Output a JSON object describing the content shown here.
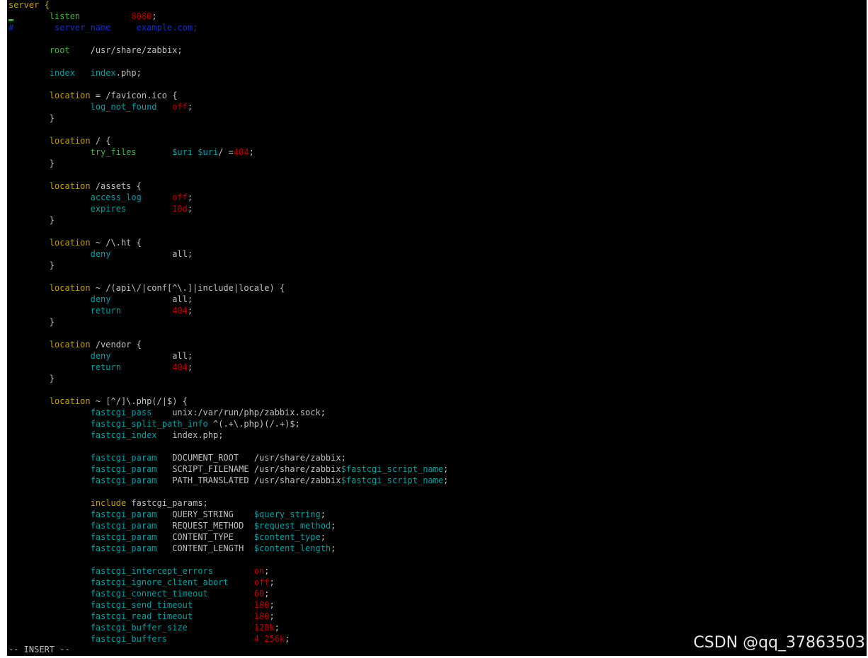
{
  "colors": {
    "default": "#c0c0c0",
    "keyword": "#c0a000",
    "directive": "#00a0a0",
    "value": "#c00000",
    "comment": "#1030c0",
    "green": "#40b040"
  },
  "editor": {
    "mode": "-- INSERT --",
    "lines": [
      [
        [
          "server {",
          "keyword"
        ]
      ],
      [
        [
          "        ",
          ""
        ],
        [
          "listen",
          "green"
        ],
        [
          "          ",
          ""
        ],
        [
          "8080",
          "value"
        ],
        [
          ";",
          ""
        ]
      ],
      [
        [
          "#",
          "comment"
        ],
        [
          "        server_name     example.com;",
          "comment"
        ]
      ],
      [],
      [
        [
          "        ",
          ""
        ],
        [
          "root",
          "green"
        ],
        [
          "    /usr/share/zabbix;",
          ""
        ]
      ],
      [],
      [
        [
          "        ",
          ""
        ],
        [
          "index",
          "directive"
        ],
        [
          "   ",
          ""
        ],
        [
          "index",
          "directive"
        ],
        [
          ".php;",
          ""
        ]
      ],
      [],
      [
        [
          "        ",
          ""
        ],
        [
          "location",
          "keyword"
        ],
        [
          " = /favicon.ico {",
          ""
        ]
      ],
      [
        [
          "                ",
          ""
        ],
        [
          "log_not_found",
          "directive"
        ],
        [
          "   ",
          ""
        ],
        [
          "off",
          "value"
        ],
        [
          ";",
          ""
        ]
      ],
      [
        [
          "        }",
          ""
        ]
      ],
      [],
      [
        [
          "        ",
          ""
        ],
        [
          "location",
          "keyword"
        ],
        [
          " / {",
          ""
        ]
      ],
      [
        [
          "                ",
          ""
        ],
        [
          "try_files",
          "green"
        ],
        [
          "       ",
          ""
        ],
        [
          "$uri $uri",
          "directive"
        ],
        [
          "/ =",
          ""
        ],
        [
          "404",
          "value"
        ],
        [
          ";",
          ""
        ]
      ],
      [
        [
          "        }",
          ""
        ]
      ],
      [],
      [
        [
          "        ",
          ""
        ],
        [
          "location",
          "keyword"
        ],
        [
          " /assets {",
          ""
        ]
      ],
      [
        [
          "                ",
          ""
        ],
        [
          "access_log",
          "directive"
        ],
        [
          "      ",
          ""
        ],
        [
          "off",
          "value"
        ],
        [
          ";",
          ""
        ]
      ],
      [
        [
          "                ",
          ""
        ],
        [
          "expires",
          "directive"
        ],
        [
          "         ",
          ""
        ],
        [
          "10d",
          "value"
        ],
        [
          ";",
          ""
        ]
      ],
      [
        [
          "        }",
          ""
        ]
      ],
      [],
      [
        [
          "        ",
          ""
        ],
        [
          "location",
          "keyword"
        ],
        [
          " ~ /\\.ht {",
          ""
        ]
      ],
      [
        [
          "                ",
          ""
        ],
        [
          "deny",
          "directive"
        ],
        [
          "            all;",
          ""
        ]
      ],
      [
        [
          "        }",
          ""
        ]
      ],
      [],
      [
        [
          "        ",
          ""
        ],
        [
          "location",
          "keyword"
        ],
        [
          " ~ /(api\\/|conf[^\\.]|include|locale) {",
          ""
        ]
      ],
      [
        [
          "                ",
          ""
        ],
        [
          "deny",
          "directive"
        ],
        [
          "            all;",
          ""
        ]
      ],
      [
        [
          "                ",
          ""
        ],
        [
          "return",
          "directive"
        ],
        [
          "          ",
          ""
        ],
        [
          "404",
          "value"
        ],
        [
          ";",
          ""
        ]
      ],
      [
        [
          "        }",
          ""
        ]
      ],
      [],
      [
        [
          "        ",
          ""
        ],
        [
          "location",
          "keyword"
        ],
        [
          " /vendor {",
          ""
        ]
      ],
      [
        [
          "                ",
          ""
        ],
        [
          "deny",
          "directive"
        ],
        [
          "            all;",
          ""
        ]
      ],
      [
        [
          "                ",
          ""
        ],
        [
          "return",
          "directive"
        ],
        [
          "          ",
          ""
        ],
        [
          "404",
          "value"
        ],
        [
          ";",
          ""
        ]
      ],
      [
        [
          "        }",
          ""
        ]
      ],
      [],
      [
        [
          "        ",
          ""
        ],
        [
          "location",
          "keyword"
        ],
        [
          " ~ [^/]\\.php(/|$) {",
          ""
        ]
      ],
      [
        [
          "                ",
          ""
        ],
        [
          "fastcgi_pass",
          "directive"
        ],
        [
          "    unix:/var/run/php/zabbix.sock;",
          ""
        ]
      ],
      [
        [
          "                ",
          ""
        ],
        [
          "fastcgi_split_path_info",
          "directive"
        ],
        [
          " ^(.+\\.php)(/.+)$;",
          ""
        ]
      ],
      [
        [
          "                ",
          ""
        ],
        [
          "fastcgi_index",
          "directive"
        ],
        [
          "   index.php;",
          ""
        ]
      ],
      [],
      [
        [
          "                ",
          ""
        ],
        [
          "fastcgi_param",
          "directive"
        ],
        [
          "   DOCUMENT_ROOT   /usr/share/zabbix;",
          ""
        ]
      ],
      [
        [
          "                ",
          ""
        ],
        [
          "fastcgi_param",
          "directive"
        ],
        [
          "   SCRIPT_FILENAME /usr/share/zabbix",
          ""
        ],
        [
          "$fastcgi_script_name",
          "directive"
        ],
        [
          ";",
          ""
        ]
      ],
      [
        [
          "                ",
          ""
        ],
        [
          "fastcgi_param",
          "directive"
        ],
        [
          "   PATH_TRANSLATED /usr/share/zabbix",
          ""
        ],
        [
          "$fastcgi_script_name",
          "directive"
        ],
        [
          ";",
          ""
        ]
      ],
      [],
      [
        [
          "                ",
          ""
        ],
        [
          "include",
          "keyword"
        ],
        [
          " fastcgi_params;",
          ""
        ]
      ],
      [
        [
          "                ",
          ""
        ],
        [
          "fastcgi_param",
          "directive"
        ],
        [
          "   QUERY_STRING    ",
          ""
        ],
        [
          "$query_string",
          "directive"
        ],
        [
          ";",
          ""
        ]
      ],
      [
        [
          "                ",
          ""
        ],
        [
          "fastcgi_param",
          "directive"
        ],
        [
          "   REQUEST_METHOD  ",
          ""
        ],
        [
          "$request_method",
          "directive"
        ],
        [
          ";",
          ""
        ]
      ],
      [
        [
          "                ",
          ""
        ],
        [
          "fastcgi_param",
          "directive"
        ],
        [
          "   CONTENT_TYPE    ",
          ""
        ],
        [
          "$content_type",
          "directive"
        ],
        [
          ";",
          ""
        ]
      ],
      [
        [
          "                ",
          ""
        ],
        [
          "fastcgi_param",
          "directive"
        ],
        [
          "   CONTENT_LENGTH  ",
          ""
        ],
        [
          "$content_length",
          "directive"
        ],
        [
          ";",
          ""
        ]
      ],
      [],
      [
        [
          "                ",
          ""
        ],
        [
          "fastcgi_intercept_errors",
          "directive"
        ],
        [
          "        ",
          ""
        ],
        [
          "on",
          "value"
        ],
        [
          ";",
          ""
        ]
      ],
      [
        [
          "                ",
          ""
        ],
        [
          "fastcgi_ignore_client_abort",
          "directive"
        ],
        [
          "     ",
          ""
        ],
        [
          "off",
          "value"
        ],
        [
          ";",
          ""
        ]
      ],
      [
        [
          "                ",
          ""
        ],
        [
          "fastcgi_connect_timeout",
          "directive"
        ],
        [
          "         ",
          ""
        ],
        [
          "60",
          "value"
        ],
        [
          ";",
          ""
        ]
      ],
      [
        [
          "                ",
          ""
        ],
        [
          "fastcgi_send_timeout",
          "directive"
        ],
        [
          "            ",
          ""
        ],
        [
          "180",
          "value"
        ],
        [
          ";",
          ""
        ]
      ],
      [
        [
          "                ",
          ""
        ],
        [
          "fastcgi_read_timeout",
          "directive"
        ],
        [
          "            ",
          ""
        ],
        [
          "180",
          "value"
        ],
        [
          ";",
          ""
        ]
      ],
      [
        [
          "                ",
          ""
        ],
        [
          "fastcgi_buffer_size",
          "directive"
        ],
        [
          "             ",
          ""
        ],
        [
          "128",
          "value"
        ],
        [
          "k",
          "value"
        ],
        [
          ";",
          ""
        ]
      ],
      [
        [
          "                ",
          ""
        ],
        [
          "fastcgi_buffers",
          "directive"
        ],
        [
          "                 ",
          ""
        ],
        [
          "4 256k",
          "value"
        ],
        [
          ";",
          ""
        ]
      ]
    ]
  },
  "watermark": "CSDN @qq_37863503"
}
